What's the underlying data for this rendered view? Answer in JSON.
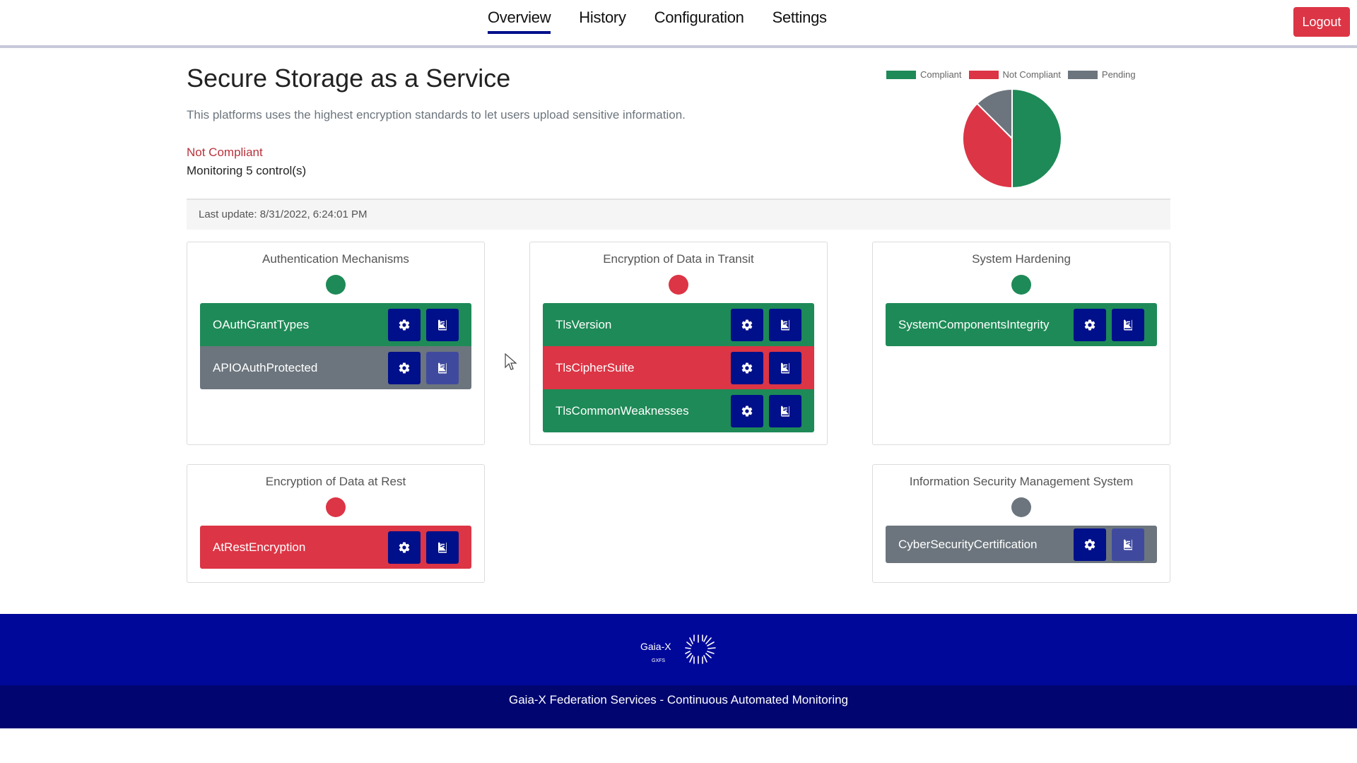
{
  "nav": {
    "tabs": [
      {
        "label": "Overview",
        "active": true
      },
      {
        "label": "History",
        "active": false
      },
      {
        "label": "Configuration",
        "active": false
      },
      {
        "label": "Settings",
        "active": false
      }
    ],
    "logout_label": "Logout"
  },
  "service": {
    "title": "Secure Storage as a Service",
    "description": "This platforms uses the highest encryption standards to let users upload sensitive information.",
    "status": "Not Compliant",
    "monitoring": "Monitoring 5 control(s)",
    "last_update": "Last update: 8/31/2022, 6:24:01 PM"
  },
  "chart_data": {
    "type": "pie",
    "categories": [
      "Compliant",
      "Not Compliant",
      "Pending"
    ],
    "values": [
      4,
      3,
      1
    ],
    "colors": [
      "#1e8a57",
      "#dc3545",
      "#6c757d"
    ],
    "legend_position": "top"
  },
  "colors": {
    "compliant": "#1e8a57",
    "not_compliant": "#dc3545",
    "pending": "#6c757d",
    "action_button": "#000f8a",
    "footer": "#00089a"
  },
  "cards": [
    {
      "title": "Authentication Mechanisms",
      "status": "compliant",
      "controls": [
        {
          "name": "OAuthGrantTypes",
          "status": "compliant"
        },
        {
          "name": "APIOAuthProtected",
          "status": "pending"
        }
      ]
    },
    {
      "title": "Encryption of Data in Transit",
      "status": "not_compliant",
      "controls": [
        {
          "name": "TlsVersion",
          "status": "compliant"
        },
        {
          "name": "TlsCipherSuite",
          "status": "not_compliant"
        },
        {
          "name": "TlsCommonWeaknesses",
          "status": "compliant"
        }
      ]
    },
    {
      "title": "System Hardening",
      "status": "compliant",
      "controls": [
        {
          "name": "SystemComponentsIntegrity",
          "status": "compliant"
        }
      ]
    },
    {
      "title": "Encryption of Data at Rest",
      "status": "not_compliant",
      "controls": [
        {
          "name": "AtRestEncryption",
          "status": "not_compliant"
        }
      ]
    },
    {
      "title": "Information Security Management System",
      "status": "pending",
      "controls": [
        {
          "name": "CyberSecurityCertification",
          "status": "pending"
        }
      ]
    }
  ],
  "icons": {
    "settings": "gear-icon",
    "evidence": "book-icon"
  },
  "footer": {
    "logo_text": "Gaia-X",
    "logo_subtext": "GXFS",
    "caption": "Gaia-X Federation Services - Continuous Automated Monitoring"
  }
}
